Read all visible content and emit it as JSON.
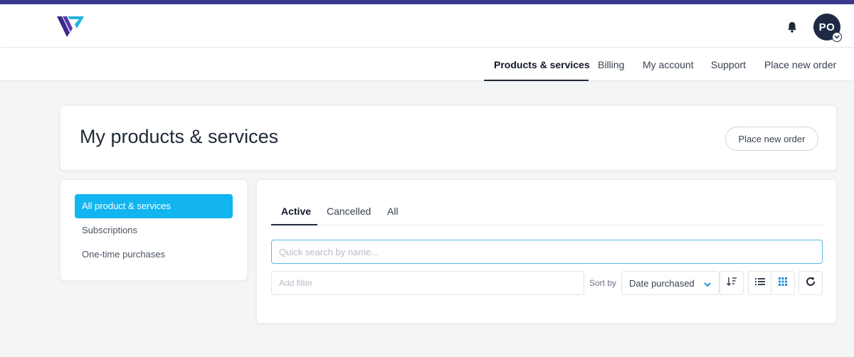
{
  "header": {
    "avatar_initials": "PO"
  },
  "nav": {
    "items": [
      {
        "label": "Products & services",
        "active": true
      },
      {
        "label": "Billing"
      },
      {
        "label": "My account"
      },
      {
        "label": "Support"
      },
      {
        "label": "Place new order"
      }
    ]
  },
  "page": {
    "title": "My products & services",
    "place_order_label": "Place new order"
  },
  "sidebar": {
    "items": [
      {
        "label": "All product & services",
        "active": true
      },
      {
        "label": "Subscriptions"
      },
      {
        "label": "One-time purchases"
      }
    ]
  },
  "tabs": [
    {
      "label": "Active",
      "active": true
    },
    {
      "label": "Cancelled"
    },
    {
      "label": "All"
    }
  ],
  "search": {
    "placeholder": "Quick search by name..."
  },
  "filter": {
    "placeholder": "Add filter"
  },
  "sort": {
    "label": "Sort by",
    "selected": "Date purchased"
  },
  "view": {
    "list_icon": "list-view-icon",
    "grid_icon": "grid-view-icon",
    "active": "grid"
  },
  "icons": {
    "logo": "logo-v-icon",
    "bell": "bell-icon",
    "sort_direction": "sort-descending-icon",
    "refresh": "refresh-icon",
    "chevron": "chevron-down-icon"
  },
  "colors": {
    "brand_stripe": "#3b3a8f",
    "accent": "#12b5f0",
    "avatar_bg": "#1e2a44",
    "search_focus": "#5ab8e8",
    "grid_icon_active": "#1a8fd6"
  }
}
